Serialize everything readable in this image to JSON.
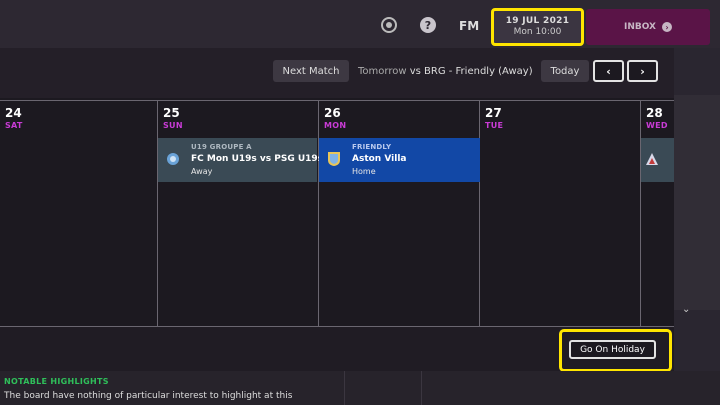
{
  "topbar": {
    "fm_label": "FM",
    "date": "19 JUL 2021",
    "time": "Mon 10:00",
    "inbox_label": "INBOX",
    "icons": {
      "globe": "globe-icon",
      "help": "help-icon",
      "inbox": "arrow-circle-icon"
    },
    "colors": {
      "inbox_bg": "#5a1447",
      "highlight": "#ffe500"
    }
  },
  "calendar": {
    "next_match_label": "Next Match",
    "next_match_when": "Tomorrow",
    "next_match_desc": "vs BRG - Friendly (Away)",
    "today_label": "Today",
    "prev_icon": "‹",
    "next_icon": "›",
    "days": [
      {
        "num": "24",
        "name": "SAT"
      },
      {
        "num": "25",
        "name": "SUN"
      },
      {
        "num": "26",
        "name": "MON"
      },
      {
        "num": "27",
        "name": "TUE"
      },
      {
        "num": "28",
        "name": "WED"
      }
    ],
    "events": [
      {
        "competition": "U19 GROUPE A",
        "title": "FC Mon U19s vs PSG U19s",
        "venue": "Away"
      },
      {
        "competition": "FRIENDLY",
        "title": "Aston Villa",
        "venue": "Home"
      }
    ],
    "holiday_label": "Go On Holiday"
  },
  "notable": {
    "title": "NOTABLE HIGHLIGHTS",
    "text": "The board have nothing of particular interest to highlight at this"
  }
}
